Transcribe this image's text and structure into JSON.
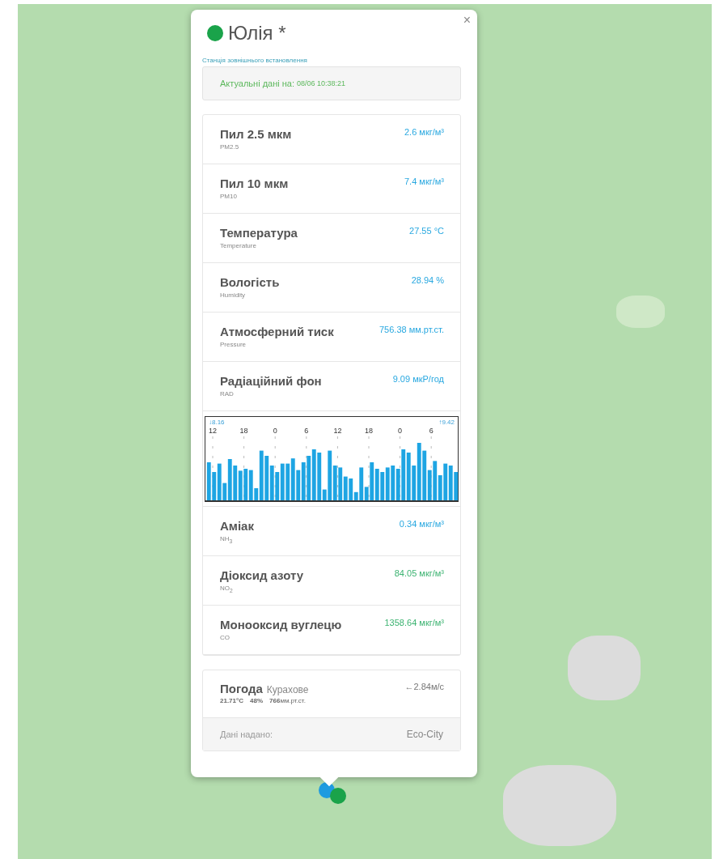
{
  "map": {
    "markers": [
      {
        "color": "#1e9be0"
      },
      {
        "color": "#1aa34a"
      }
    ]
  },
  "popup": {
    "close": "×",
    "title": "Юлія *",
    "color": "#1aa34a",
    "station_type": "Станція зовнішнього встановлення",
    "updated_label": "Актуальні дані на:",
    "updated_time": "08/06 10:38:21",
    "measurements": [
      {
        "kind": "reading",
        "name": "Пил 2.5 мкм",
        "code": "PM2.5",
        "value": "2.6 мкг/м³",
        "color": "#29a8e0"
      },
      {
        "kind": "reading",
        "name": "Пил 10 мкм",
        "code": "PM10",
        "value": "7.4 мкг/м³",
        "color": "#29a8e0"
      },
      {
        "kind": "reading",
        "name": "Температура",
        "code": "Temperature",
        "value": "27.55 °C",
        "color": "#29a8e0"
      },
      {
        "kind": "reading",
        "name": "Вологість",
        "code": "Humidity",
        "value": "28.94 %",
        "color": "#29a8e0"
      },
      {
        "kind": "reading",
        "name": "Атмосферний тиск",
        "code": "Pressure",
        "value": "756.38 мм.рт.ст.",
        "color": "#29a8e0"
      },
      {
        "kind": "reading",
        "name": "Радіаційний фон",
        "code": "RAD",
        "value": "9.09 мкР/год",
        "color": "#29a8e0"
      },
      {
        "kind": "chart",
        "min": "↓8.16",
        "max": "↑9.42",
        "hours": [
          "12",
          "18",
          "0",
          "6",
          "12",
          "18",
          "0",
          "6"
        ]
      },
      {
        "kind": "reading",
        "name": "Аміак",
        "code": "NH$_{3}$",
        "value": "0.34 мкг/м³",
        "color": "#29a8e0"
      },
      {
        "kind": "reading",
        "name": "Діоксид азоту",
        "code": "NO$_{2}$",
        "value": "84.05 мкг/м³",
        "color": "#3cb371"
      },
      {
        "kind": "reading",
        "name": "Монооксид вуглецю",
        "code": "CO",
        "value": "1358.64 мкг/м³",
        "color": "#3cb371"
      }
    ],
    "weather": {
      "label": "Погода",
      "place": "Курахове",
      "wind": "←2.84м/с",
      "temperature": "21.71°C",
      "humidity": "48%",
      "pressure": "**766**мм.рт.ст."
    },
    "source_label": "Дані надано:",
    "source": "Eco-City"
  }
}
